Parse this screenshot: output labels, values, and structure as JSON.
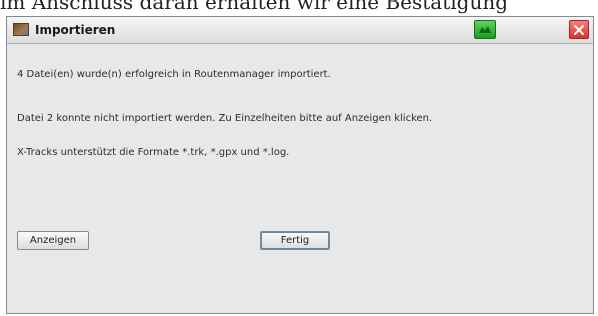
{
  "caption": "im Anschluss daran erhalten wir eine Bestätigung",
  "dialog": {
    "title": "Importieren",
    "messages": [
      "4 Datei(en) wurde(n) erfolgreich in Routenmanager importiert.",
      "Datei 2 konnte nicht importiert werden. Zu Einzelheiten bitte auf Anzeigen klicken.",
      "X-Tracks unterstützt die Formate *.trk, *.gpx und *.log."
    ],
    "buttons": {
      "show": "Anzeigen",
      "done": "Fertig"
    }
  },
  "colors": {
    "status_green": "#2fb52d",
    "close_red": "#d8342f",
    "dialog_bg": "#e8e8e8"
  },
  "icons": {
    "app": "app-icon",
    "status": "status-icon",
    "close": "close-icon"
  }
}
